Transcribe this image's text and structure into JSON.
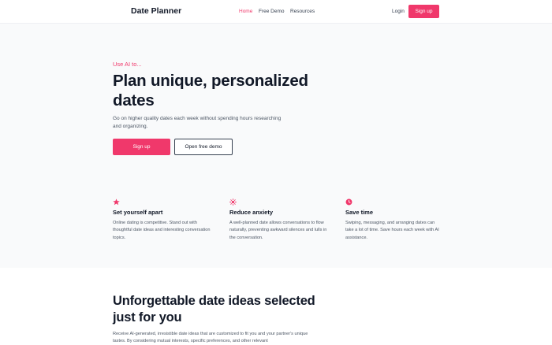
{
  "nav": {
    "brand": "Date Planner",
    "links": [
      {
        "label": "Home",
        "active": true
      },
      {
        "label": "Free Demo",
        "active": false
      },
      {
        "label": "Resources",
        "active": false
      }
    ],
    "login": "Login",
    "signup": "Sign up"
  },
  "hero": {
    "eyebrow": "Use AI to...",
    "title": "Plan unique, personalized dates",
    "subtitle": "Go on higher quality dates each week without spending hours researching and organizing.",
    "primary_button": "Sign up",
    "secondary_button": "Open free demo"
  },
  "features": [
    {
      "icon": "star-icon",
      "title": "Set yourself apart",
      "text": "Online dating is competitive. Stand out with thoughtful date ideas and interesting conversation topics."
    },
    {
      "icon": "sun-icon",
      "title": "Reduce anxiety",
      "text": "A well-planned date allows conversations to flow naturally, preventing awkward silences and lulls in the conversation."
    },
    {
      "icon": "clock-icon",
      "title": "Save time",
      "text": "Swiping, messaging, and arranging dates can take a lot of time. Save hours each week with AI assistance."
    }
  ],
  "section2": {
    "title": "Unforgettable date ideas selected just for you",
    "description": "Receive AI-generated, irresistible date ideas that are customized to fit you and your partner's unique tastes. By considering mutual interests, specific preferences, and other relevant"
  },
  "colors": {
    "accent": "#f0386b",
    "text": "#111827",
    "muted": "#4b5563",
    "background": "#f9fafb"
  }
}
